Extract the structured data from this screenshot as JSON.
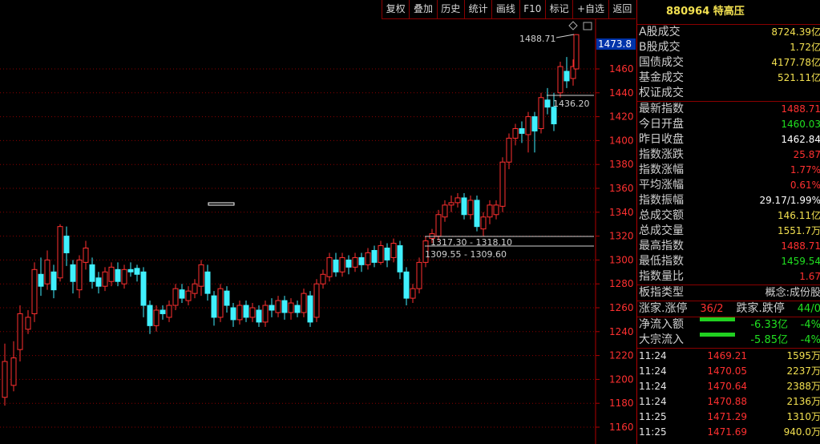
{
  "toolbar": [
    "复权",
    "叠加",
    "历史",
    "统计",
    "画线",
    "F10",
    "标记",
    "+自选",
    "返回"
  ],
  "chart": {
    "price_ticks": [
      "1460",
      "1440",
      "1420",
      "1400",
      "1380",
      "1360",
      "1340",
      "1320",
      "1300",
      "1280",
      "1260",
      "1240",
      "1220",
      "1200",
      "1180",
      "1160"
    ],
    "current_price_label": "1473.8",
    "annotations": {
      "high": "1488.71",
      "mid": "1436.20",
      "gap_top": "1317.30 - 1318.10",
      "gap_bottom": "1309.55 - 1309.60"
    },
    "colors": {
      "up": "#ff3030",
      "down": "#40f0ff",
      "grid": "#8a0000"
    }
  },
  "panel": {
    "title": "880964 特高压",
    "volumes": [
      {
        "label": "A股成交",
        "value": "8724.39亿",
        "color": "yellow"
      },
      {
        "label": "B股成交",
        "value": "1.72亿",
        "color": "yellow"
      },
      {
        "label": "国债成交",
        "value": "4177.78亿",
        "color": "yellow"
      },
      {
        "label": "基金成交",
        "value": "521.11亿",
        "color": "yellow"
      },
      {
        "label": "权证成交",
        "value": "",
        "color": "yellow"
      }
    ],
    "stats": [
      {
        "label": "最新指数",
        "value": "1488.71",
        "color": "red"
      },
      {
        "label": "今日开盘",
        "value": "1460.03",
        "color": "green"
      },
      {
        "label": "昨日收盘",
        "value": "1462.84",
        "color": "white"
      },
      {
        "label": "指数涨跌",
        "value": "25.87",
        "color": "red"
      },
      {
        "label": "指数涨幅",
        "value": "1.77%",
        "color": "red"
      },
      {
        "label": "平均涨幅",
        "value": "0.61%",
        "color": "red"
      },
      {
        "label": "指数振幅",
        "value": "29.17/1.99%",
        "color": "white"
      },
      {
        "label": "总成交额",
        "value": "146.11亿",
        "color": "yellow"
      },
      {
        "label": "总成交量",
        "value": "1551.7万",
        "color": "yellow"
      },
      {
        "label": "最高指数",
        "value": "1488.71",
        "color": "red"
      },
      {
        "label": "最低指数",
        "value": "1459.54",
        "color": "green"
      },
      {
        "label": "指数量比",
        "value": "1.67",
        "color": "red"
      }
    ],
    "board_type": {
      "label": "板指类型",
      "value": "概念:成份股"
    },
    "updown": {
      "rise_label": "涨家.涨停",
      "rise_value": "36/2",
      "fall_label": "跌家.跌停",
      "fall_value": "44/0"
    },
    "flows": [
      {
        "label": "净流入额",
        "amount": "-6.33亿",
        "pct": "-4%"
      },
      {
        "label": "大宗流入",
        "amount": "-5.85亿",
        "pct": "-4%"
      }
    ],
    "ticks": [
      {
        "time": "11:24",
        "price": "1469.21",
        "vol": "1595万"
      },
      {
        "time": "11:24",
        "price": "1470.05",
        "vol": "2237万"
      },
      {
        "time": "11:24",
        "price": "1470.64",
        "vol": "2388万"
      },
      {
        "time": "11:24",
        "price": "1470.88",
        "vol": "2136万"
      },
      {
        "time": "11:25",
        "price": "1471.29",
        "vol": "1310万"
      },
      {
        "time": "11:25",
        "price": "1471.69",
        "vol": "940.0万"
      }
    ]
  }
}
